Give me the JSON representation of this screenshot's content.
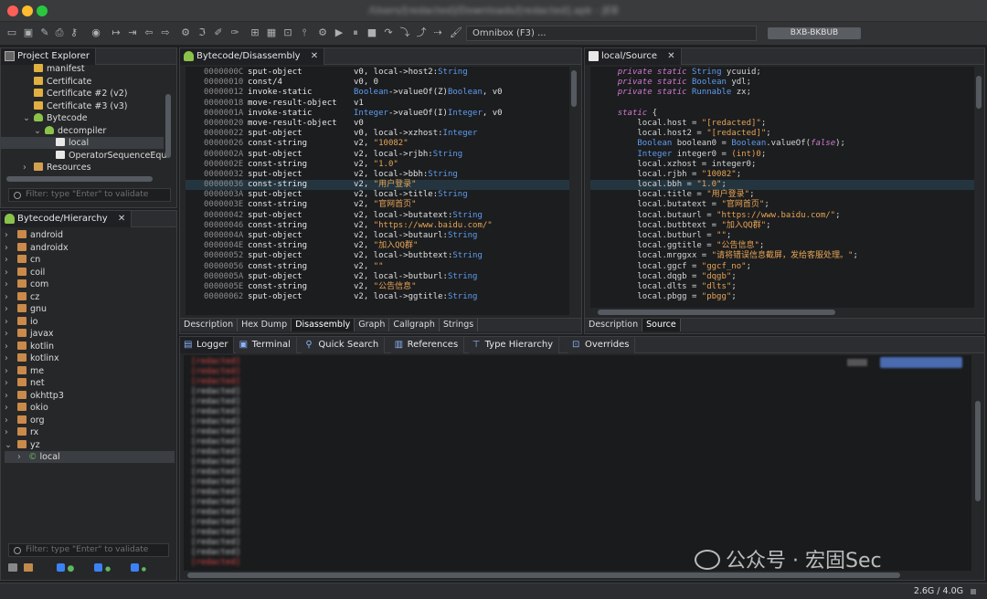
{
  "window": {
    "title": "/Users/[redacted]/Downloads/[redacted].apk - JEB"
  },
  "toolbar": {
    "omnibox": "Omnibox (F3) ...",
    "memory_button": "BXB-BKBUB"
  },
  "project_explorer": {
    "tab": "Project Explorer",
    "filter_placeholder": "Filter: type \"Enter\" to validate",
    "items": [
      {
        "label": "manifest",
        "indent": 3,
        "icon": "cert"
      },
      {
        "label": "Certificate",
        "indent": 3,
        "icon": "cert"
      },
      {
        "label": "Certificate #2 (v2)",
        "indent": 3,
        "icon": "cert"
      },
      {
        "label": "Certificate #3 (v3)",
        "indent": 3,
        "icon": "cert"
      },
      {
        "label": "Bytecode",
        "indent": 3,
        "icon": "android",
        "arrow": "v"
      },
      {
        "label": "decompiler",
        "indent": 4,
        "icon": "dex",
        "arrow": "v"
      },
      {
        "label": "local",
        "indent": 5,
        "icon": "file",
        "selected": true
      },
      {
        "label": "OperatorSequenceEqu",
        "indent": 5,
        "icon": "file"
      },
      {
        "label": "Resources",
        "indent": 3,
        "icon": "folder",
        "arrow": ">"
      }
    ]
  },
  "hierarchy": {
    "tab": "Bytecode/Hierarchy",
    "filter_placeholder": "Filter: type \"Enter\" to validate",
    "packages": [
      "android",
      "androidx",
      "cn",
      "coil",
      "com",
      "cz",
      "gnu",
      "io",
      "javax",
      "kotlin",
      "kotlinx",
      "me",
      "net",
      "okhttp3",
      "okio",
      "org",
      "rx",
      "yz"
    ],
    "expanded": "yz",
    "child": "local"
  },
  "disassembly": {
    "tab": "Bytecode/Disassembly",
    "subtabs": [
      "Description",
      "Hex Dump",
      "Disassembly",
      "Graph",
      "Callgraph",
      "Strings"
    ],
    "active_subtab": "Disassembly",
    "lines": [
      {
        "addr": "0000000C",
        "op": "sput-object",
        "a": "v0, local->host2:String"
      },
      {
        "addr": "00000010",
        "op": "const/4",
        "a": "v0, 0"
      },
      {
        "addr": "00000012",
        "op": "invoke-static",
        "a": "Boolean->valueOf(Z)Boolean, v0"
      },
      {
        "addr": "00000018",
        "op": "move-result-object",
        "a": "v1"
      },
      {
        "addr": "0000001A",
        "op": "invoke-static",
        "a": "Integer->valueOf(I)Integer, v0"
      },
      {
        "addr": "00000020",
        "op": "move-result-object",
        "a": "v0"
      },
      {
        "addr": "00000022",
        "op": "sput-object",
        "a": "v0, local->xzhost:Integer"
      },
      {
        "addr": "00000026",
        "op": "const-string",
        "a": "v2, \"10082\""
      },
      {
        "addr": "0000002A",
        "op": "sput-object",
        "a": "v2, local->rjbh:String"
      },
      {
        "addr": "0000002E",
        "op": "const-string",
        "a": "v2, \"1.0\""
      },
      {
        "addr": "00000032",
        "op": "sput-object",
        "a": "v2, local->bbh:String"
      },
      {
        "addr": "00000036",
        "op": "const-string",
        "a": "v2, \"用户登录\"",
        "hl": true
      },
      {
        "addr": "0000003A",
        "op": "sput-object",
        "a": "v2, local->title:String"
      },
      {
        "addr": "0000003E",
        "op": "const-string",
        "a": "v2, \"官网首页\""
      },
      {
        "addr": "00000042",
        "op": "sput-object",
        "a": "v2, local->butatext:String"
      },
      {
        "addr": "00000046",
        "op": "const-string",
        "a": "v2, \"https://www.baidu.com/\""
      },
      {
        "addr": "0000004A",
        "op": "sput-object",
        "a": "v2, local->butaurl:String"
      },
      {
        "addr": "0000004E",
        "op": "const-string",
        "a": "v2, \"加入QQ群\""
      },
      {
        "addr": "00000052",
        "op": "sput-object",
        "a": "v2, local->butbtext:String"
      },
      {
        "addr": "00000056",
        "op": "const-string",
        "a": "v2, \"\""
      },
      {
        "addr": "0000005A",
        "op": "sput-object",
        "a": "v2, local->butburl:String"
      },
      {
        "addr": "0000005E",
        "op": "const-string",
        "a": "v2, \"公告信息\""
      },
      {
        "addr": "00000062",
        "op": "sput-object",
        "a": "v2, local->ggtitle:String"
      }
    ]
  },
  "source": {
    "tab": "local/Source",
    "subtabs": [
      "Description",
      "Source"
    ],
    "active_subtab": "Source",
    "lines": [
      "    private static String ycuuid;",
      "    private static Boolean ydl;",
      "    private static Runnable zx;",
      "",
      "    static {",
      "        local.host = \"[redacted]\";",
      "        local.host2 = \"[redacted]\";",
      "        Boolean boolean0 = Boolean.valueOf(false);",
      "        Integer integer0 = (int)0;",
      "        local.xzhost = integer0;",
      "        local.rjbh = \"10082\";",
      "        local.bbh = \"1.0\";",
      "        local.title = \"用户登录\";",
      "        local.butatext = \"官网首页\";",
      "        local.butaurl = \"https://www.baidu.com/\";",
      "        local.butbtext = \"加入QQ群\";",
      "        local.butburl = \"\";",
      "        local.ggtitle = \"公告信息\";",
      "        local.mrggxx = \"请将错误信息截屏，发给客服处理。\";",
      "        local.ggcf = \"ggcf_no\";",
      "        local.dqgb = \"dqgb\";",
      "        local.dlts = \"dlts\";",
      "        local.pbgg = \"pbgg\";"
    ],
    "highlight_line": 11
  },
  "console": {
    "tabs": [
      "Logger",
      "Terminal",
      "Quick Search",
      "References",
      "Type Hierarchy",
      "Overrides"
    ],
    "active": "Logger"
  },
  "statusbar": {
    "memory": "2.6G / 4.0G"
  },
  "watermark": "公众号 · 宏固Sec",
  "colors": {
    "accent": "#3b82f6",
    "error": "#e04848",
    "background": "#1e1f22"
  }
}
